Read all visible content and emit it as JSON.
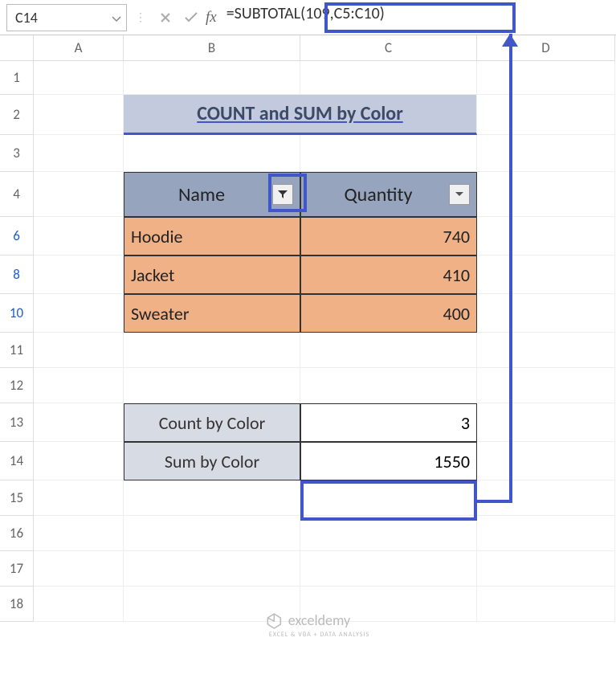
{
  "nameBox": "C14",
  "formula": "=SUBTOTAL(109,C5:C10)",
  "columns": [
    "A",
    "B",
    "C",
    "D"
  ],
  "rowNumbers": [
    "1",
    "2",
    "3",
    "4",
    "6",
    "8",
    "10",
    "11",
    "12",
    "13",
    "14",
    "15",
    "16",
    "17",
    "18"
  ],
  "filteredRows": [
    "6",
    "8",
    "10"
  ],
  "title": "COUNT and SUM by Color",
  "headers": {
    "name": "Name",
    "qty": "Quantity"
  },
  "data": [
    {
      "name": "Hoodie",
      "qty": "740"
    },
    {
      "name": "Jacket",
      "qty": "410"
    },
    {
      "name": "Sweater",
      "qty": "400"
    }
  ],
  "summary": {
    "countLabel": "Count by Color",
    "countVal": "3",
    "sumLabel": "Sum by Color",
    "sumVal": "1550"
  },
  "logo": "exceldemy",
  "logoSub": "EXCEL & VBA + DATA ANALYSIS"
}
